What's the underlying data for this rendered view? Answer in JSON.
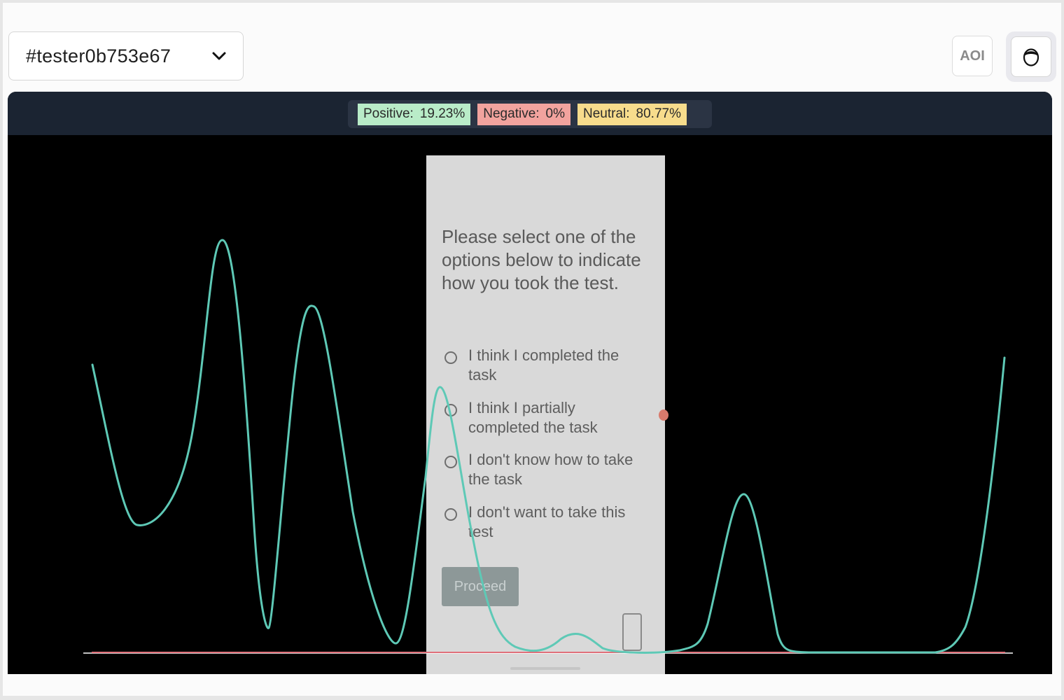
{
  "header": {
    "tester_label": "#tester0b753e67",
    "aoi_label": "AOI"
  },
  "sentiment": {
    "positive": {
      "label": "Positive:",
      "value": "19.23%",
      "color": "#b9ecc8"
    },
    "negative": {
      "label": "Negative:",
      "value": "0%",
      "color": "#f2a39e"
    },
    "neutral": {
      "label": "Neutral:",
      "value": "80.77%",
      "color": "#f7dc8c"
    }
  },
  "phone_screen": {
    "question": "Please select one of the options below to indicate how you took the test.",
    "options": [
      "I think I completed the task",
      "I think I partially completed the task",
      "I don't know how to take the task",
      "I don't want to take this test"
    ],
    "proceed_label": "Proceed"
  },
  "colors": {
    "emotion_line": "#5ec9b6",
    "baseline": "#e0707a",
    "panel_bg": "#000000",
    "topbar_bg": "#1b2432"
  }
}
